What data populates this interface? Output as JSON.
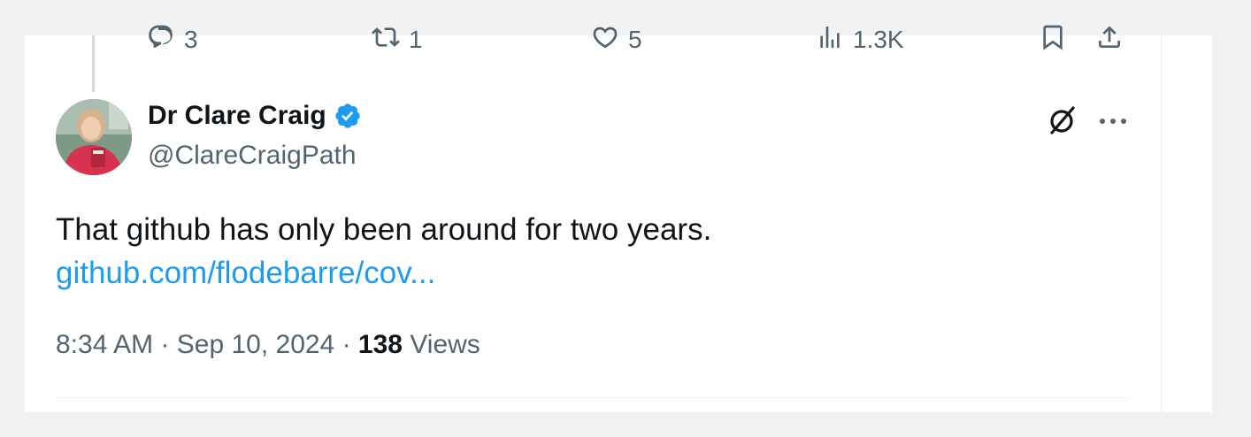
{
  "actions": {
    "reply_count": "3",
    "repost_count": "1",
    "like_count": "5",
    "views_count": "1.3K"
  },
  "author": {
    "display_name": "Dr Clare Craig",
    "handle": "@ClareCraigPath",
    "verified": true
  },
  "tweet": {
    "text": "That github has only been around for two years.",
    "link_text": "github.com/flodebarre/cov..."
  },
  "meta": {
    "time": "8:34 AM",
    "separator1": " · ",
    "date": "Sep 10, 2024",
    "separator2": " · ",
    "views_number": "138",
    "views_label": " Views"
  },
  "colors": {
    "accent": "#1d9bf0",
    "text_primary": "#0f1419",
    "text_secondary": "#536471",
    "background": "#f2f2f2"
  },
  "icons": [
    "reply-icon",
    "repost-icon",
    "like-icon",
    "views-icon",
    "bookmark-icon",
    "share-icon",
    "verified-badge-icon",
    "grok-icon",
    "more-icon"
  ]
}
